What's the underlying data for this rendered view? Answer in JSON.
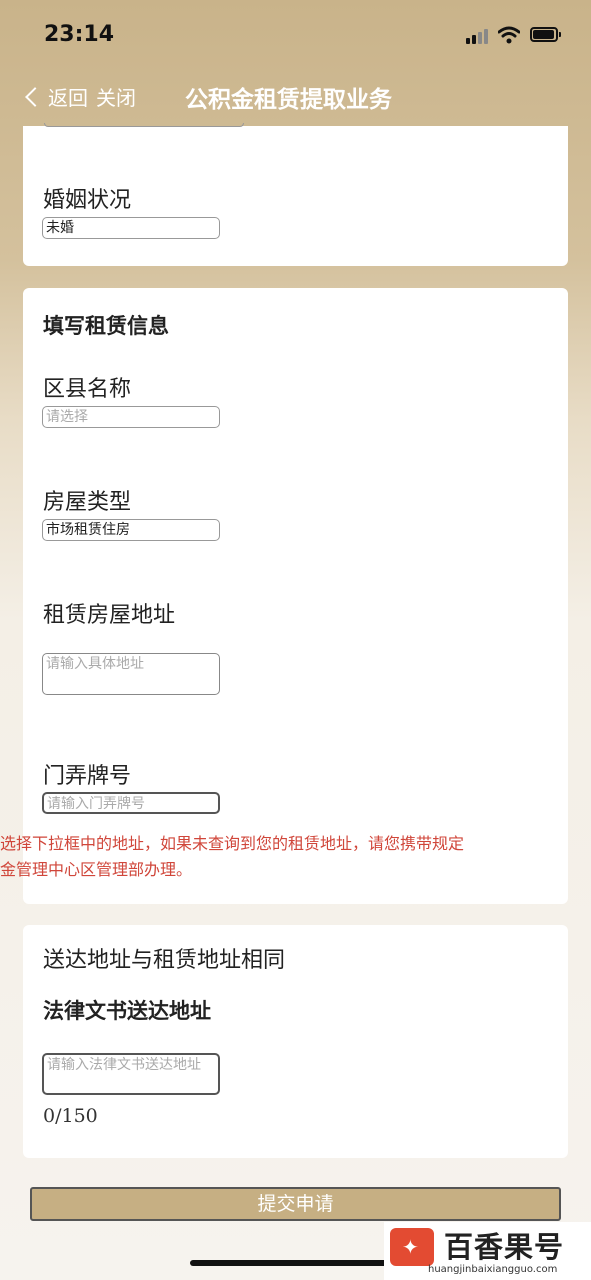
{
  "status": {
    "time": "23:14"
  },
  "nav": {
    "back_label": "返回",
    "close_label": "关闭",
    "title": "公积金租赁提取业务"
  },
  "marital": {
    "label": "婚姻状况",
    "value": "未婚"
  },
  "rental": {
    "section_title": "填写租赁信息",
    "district": {
      "label": "区县名称",
      "placeholder": "请选择"
    },
    "house_type": {
      "label": "房屋类型",
      "value": "市场租赁住房"
    },
    "address": {
      "label": "租赁房屋地址",
      "placeholder": "请输入具体地址"
    },
    "door_number": {
      "label": "门弄牌号",
      "placeholder": "请输入门弄牌号"
    },
    "notice_line1": "选择下拉框中的地址，如果未查询到您的租赁地址，请您携带规定",
    "notice_line2": "金管理中心区管理部办理。"
  },
  "delivery": {
    "same_address_label": "送达地址与租赁地址相同",
    "legal_title": "法律文书送达地址",
    "legal_placeholder": "请输入法律文书送达地址",
    "counter": "0/150"
  },
  "submit_label": "提交申请",
  "watermark": {
    "brand": "百香果号",
    "url": "huangjinbaixiangguo.com"
  }
}
